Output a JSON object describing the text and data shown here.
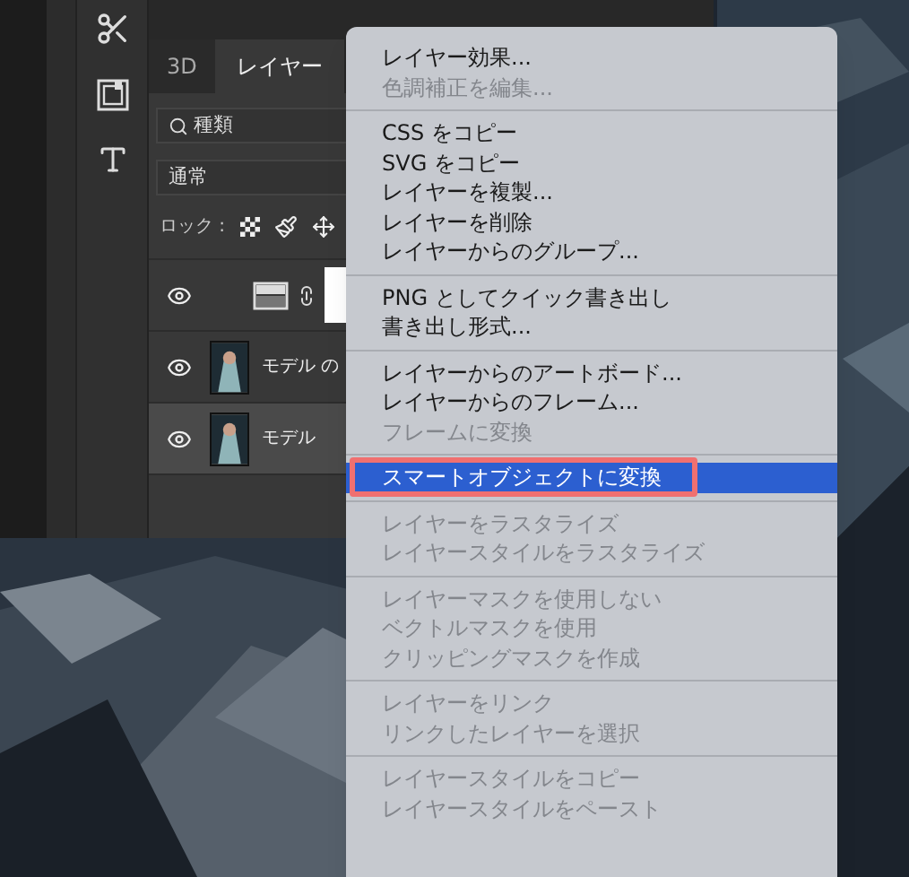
{
  "panel": {
    "tabs": [
      {
        "label": "3D",
        "selected": false
      },
      {
        "label": "レイヤー",
        "selected": true
      }
    ],
    "filter": {
      "value": "種類"
    },
    "blend_mode": {
      "value": "通常"
    },
    "lock": {
      "label": "ロック :"
    },
    "layers": [
      {
        "kind": "adjustment",
        "visible": true,
        "selected": false
      },
      {
        "name": "モデル の",
        "visible": true,
        "selected": false
      },
      {
        "name": "モデル",
        "visible": true,
        "selected": true
      }
    ]
  },
  "context_menu": {
    "groups": [
      [
        {
          "label": "レイヤー効果...",
          "disabled": false,
          "selected": false,
          "annotated": false
        },
        {
          "label": "色調補正を編集...",
          "disabled": true,
          "selected": false,
          "annotated": false
        }
      ],
      [
        {
          "label": "CSS をコピー",
          "disabled": false,
          "selected": false,
          "annotated": false
        },
        {
          "label": "SVG をコピー",
          "disabled": false,
          "selected": false,
          "annotated": false
        },
        {
          "label": "レイヤーを複製...",
          "disabled": false,
          "selected": false,
          "annotated": false
        },
        {
          "label": "レイヤーを削除",
          "disabled": false,
          "selected": false,
          "annotated": false
        },
        {
          "label": "レイヤーからのグループ...",
          "disabled": false,
          "selected": false,
          "annotated": false
        }
      ],
      [
        {
          "label": "PNG としてクイック書き出し",
          "disabled": false,
          "selected": false,
          "annotated": false
        },
        {
          "label": "書き出し形式...",
          "disabled": false,
          "selected": false,
          "annotated": false
        }
      ],
      [
        {
          "label": "レイヤーからのアートボード...",
          "disabled": false,
          "selected": false,
          "annotated": false
        },
        {
          "label": "レイヤーからのフレーム...",
          "disabled": false,
          "selected": false,
          "annotated": false
        },
        {
          "label": "フレームに変換",
          "disabled": true,
          "selected": false,
          "annotated": false
        }
      ],
      [
        {
          "label": "スマートオブジェクトに変換",
          "disabled": false,
          "selected": true,
          "annotated": true
        }
      ],
      [
        {
          "label": "レイヤーをラスタライズ",
          "disabled": true,
          "selected": false,
          "annotated": false
        },
        {
          "label": "レイヤースタイルをラスタライズ",
          "disabled": true,
          "selected": false,
          "annotated": false
        }
      ],
      [
        {
          "label": "レイヤーマスクを使用しない",
          "disabled": true,
          "selected": false,
          "annotated": false
        },
        {
          "label": "ベクトルマスクを使用",
          "disabled": true,
          "selected": false,
          "annotated": false
        },
        {
          "label": "クリッピングマスクを作成",
          "disabled": true,
          "selected": false,
          "annotated": false
        }
      ],
      [
        {
          "label": "レイヤーをリンク",
          "disabled": true,
          "selected": false,
          "annotated": false
        },
        {
          "label": "リンクしたレイヤーを選択",
          "disabled": true,
          "selected": false,
          "annotated": false
        }
      ],
      [
        {
          "label": "レイヤースタイルをコピー",
          "disabled": true,
          "selected": false,
          "annotated": false
        },
        {
          "label": "レイヤースタイルをペースト",
          "disabled": true,
          "selected": false,
          "annotated": false
        }
      ]
    ]
  }
}
